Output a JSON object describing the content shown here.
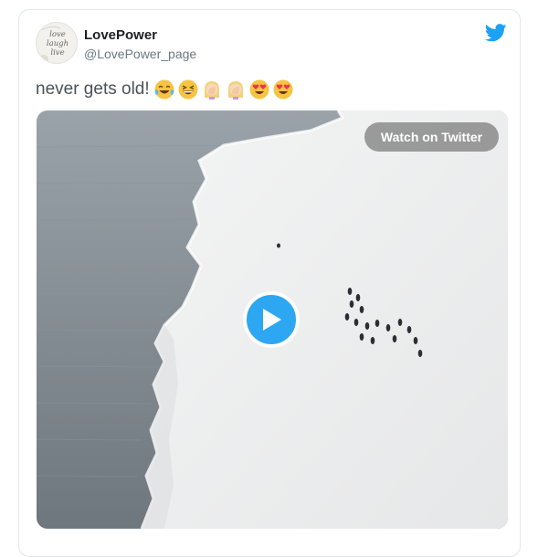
{
  "author": {
    "name": "LovePower",
    "handle": "@LovePower_page",
    "avatar_text": "love laugh live"
  },
  "tweet": {
    "text": "never gets old!",
    "emojis": [
      "face-with-tears-of-joy",
      "grinning-squinting-face",
      "woman-facepalming",
      "woman-facepalming",
      "smiling-face-with-heart-eyes",
      "smiling-face-with-heart-eyes"
    ]
  },
  "media": {
    "watch_label": "Watch on Twitter",
    "play_icon": "play-icon"
  },
  "colors": {
    "brand": "#1da1f2",
    "text": "#1c2022",
    "muted": "#697882"
  }
}
